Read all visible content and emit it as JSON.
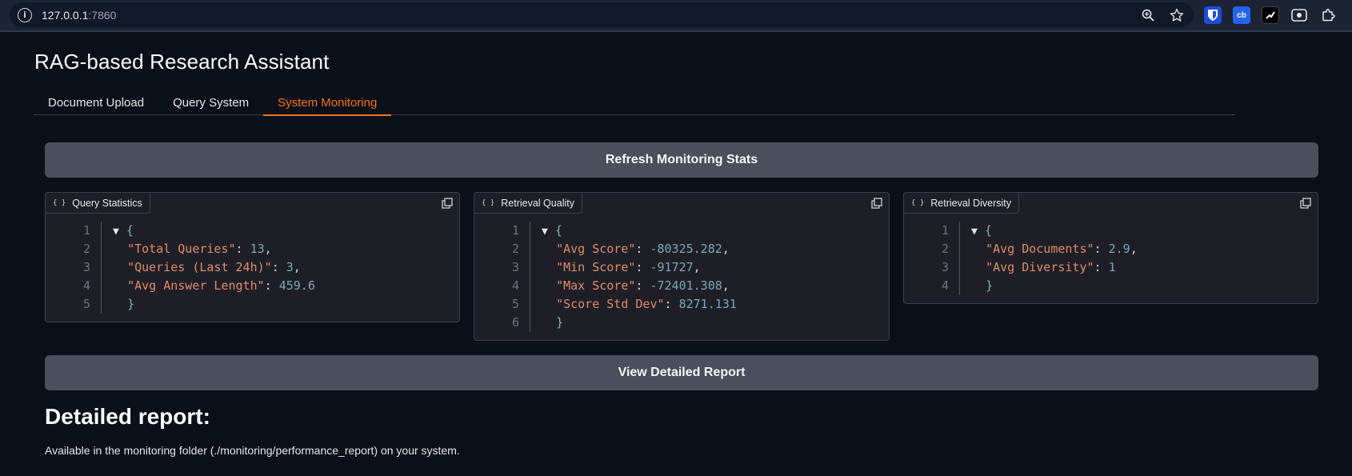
{
  "browser": {
    "url_host": "127.0.0.1",
    "url_port": ":7860"
  },
  "app": {
    "title": "RAG-based Research Assistant"
  },
  "tabs": [
    {
      "label": "Document Upload"
    },
    {
      "label": "Query System"
    },
    {
      "label": "System Monitoring"
    }
  ],
  "buttons": {
    "refresh": "Refresh Monitoring Stats",
    "view_report": "View Detailed Report"
  },
  "panels": [
    {
      "label": "Query Statistics",
      "entries": [
        {
          "key": "\"Total Queries\"",
          "value": "13"
        },
        {
          "key": "\"Queries (Last 24h)\"",
          "value": "3"
        },
        {
          "key": "\"Avg Answer Length\"",
          "value": "459.6"
        }
      ]
    },
    {
      "label": "Retrieval Quality",
      "entries": [
        {
          "key": "\"Avg Score\"",
          "value": "-80325.282"
        },
        {
          "key": "\"Min Score\"",
          "value": "-91727"
        },
        {
          "key": "\"Max Score\"",
          "value": "-72401.308"
        },
        {
          "key": "\"Score Std Dev\"",
          "value": "8271.131"
        }
      ]
    },
    {
      "label": "Retrieval Diversity",
      "entries": [
        {
          "key": "\"Avg Documents\"",
          "value": "2.9"
        },
        {
          "key": "\"Avg Diversity\"",
          "value": "1"
        }
      ]
    }
  ],
  "code_symbols": {
    "open_brace": "{",
    "close_brace": "}",
    "collapse_arrow": "▼",
    "braces_icon": "{ }"
  },
  "report": {
    "heading": "Detailed report:",
    "text": "Available in the monitoring folder (./monitoring/performance_report) on your system."
  },
  "colors": {
    "accent": "#f97316",
    "background": "#0b0f19",
    "button": "#4b4f5c"
  }
}
